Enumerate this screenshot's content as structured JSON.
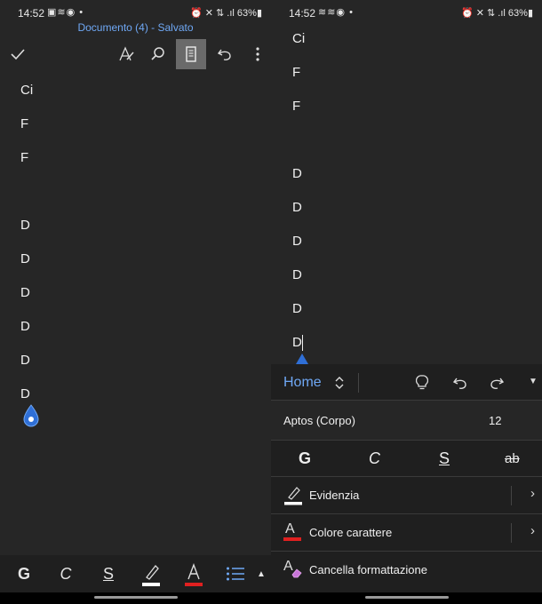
{
  "status_left": {
    "time": "14:52",
    "battery": "63%"
  },
  "status_right": {
    "time": "14:52",
    "battery": "63%"
  },
  "document_title": "Documento (4) - Salvato",
  "left_lines": [
    "Ci",
    "F",
    "F",
    "D",
    "D",
    "D",
    "D",
    "D",
    "D"
  ],
  "right_lines": [
    "Ci",
    "F",
    "F",
    "D",
    "D",
    "D",
    "D",
    "D",
    "D"
  ],
  "bottom_format": {
    "bold": "G",
    "italic": "C",
    "underline": "S",
    "highlight_label": "",
    "font_color_label": "A"
  },
  "ribbon": {
    "tab_label": "Home",
    "font_name": "Aptos (Corpo)",
    "font_size": "12",
    "bold": "G",
    "italic": "C",
    "underline": "S",
    "strike": "ab",
    "highlight": "Evidenzia",
    "font_color": "Colore carattere",
    "clear_format": "Cancella formattazione",
    "font_color_icon_label": "A",
    "clear_icon_label": "A"
  },
  "colors": {
    "accent": "#6fa8f5",
    "red_bar": "#e02020",
    "white_bar": "#ffffff",
    "bg": "#262626",
    "panel": "#1f1f1f"
  }
}
